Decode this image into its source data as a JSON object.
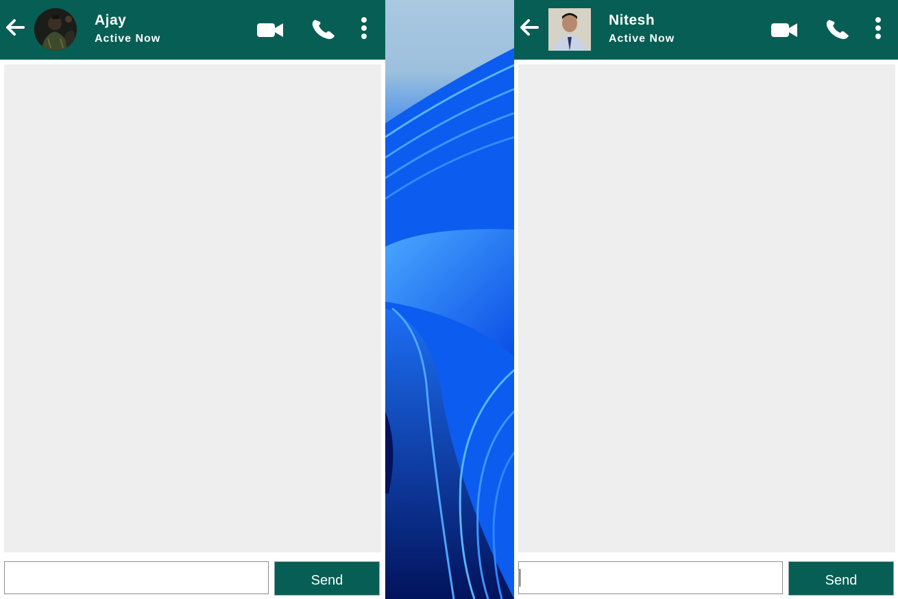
{
  "windows": [
    {
      "contact_name": "Ajay",
      "status": "Active Now",
      "input_value": "",
      "send_label": "Send",
      "avatar": "profile-photo-round",
      "icons": [
        "back-arrow-icon",
        "video-call-icon",
        "voice-call-icon",
        "more-options-icon"
      ]
    },
    {
      "contact_name": "Nitesh",
      "status": "Active Now",
      "input_value": "",
      "send_label": "Send",
      "avatar": "profile-photo-square",
      "icons": [
        "back-arrow-icon",
        "video-call-icon",
        "voice-call-icon",
        "more-options-icon"
      ]
    }
  ],
  "colors": {
    "header": "#075e54",
    "messages_background": "#eeeeee",
    "send_button": "#075e54",
    "header_text": "#ffffff"
  }
}
